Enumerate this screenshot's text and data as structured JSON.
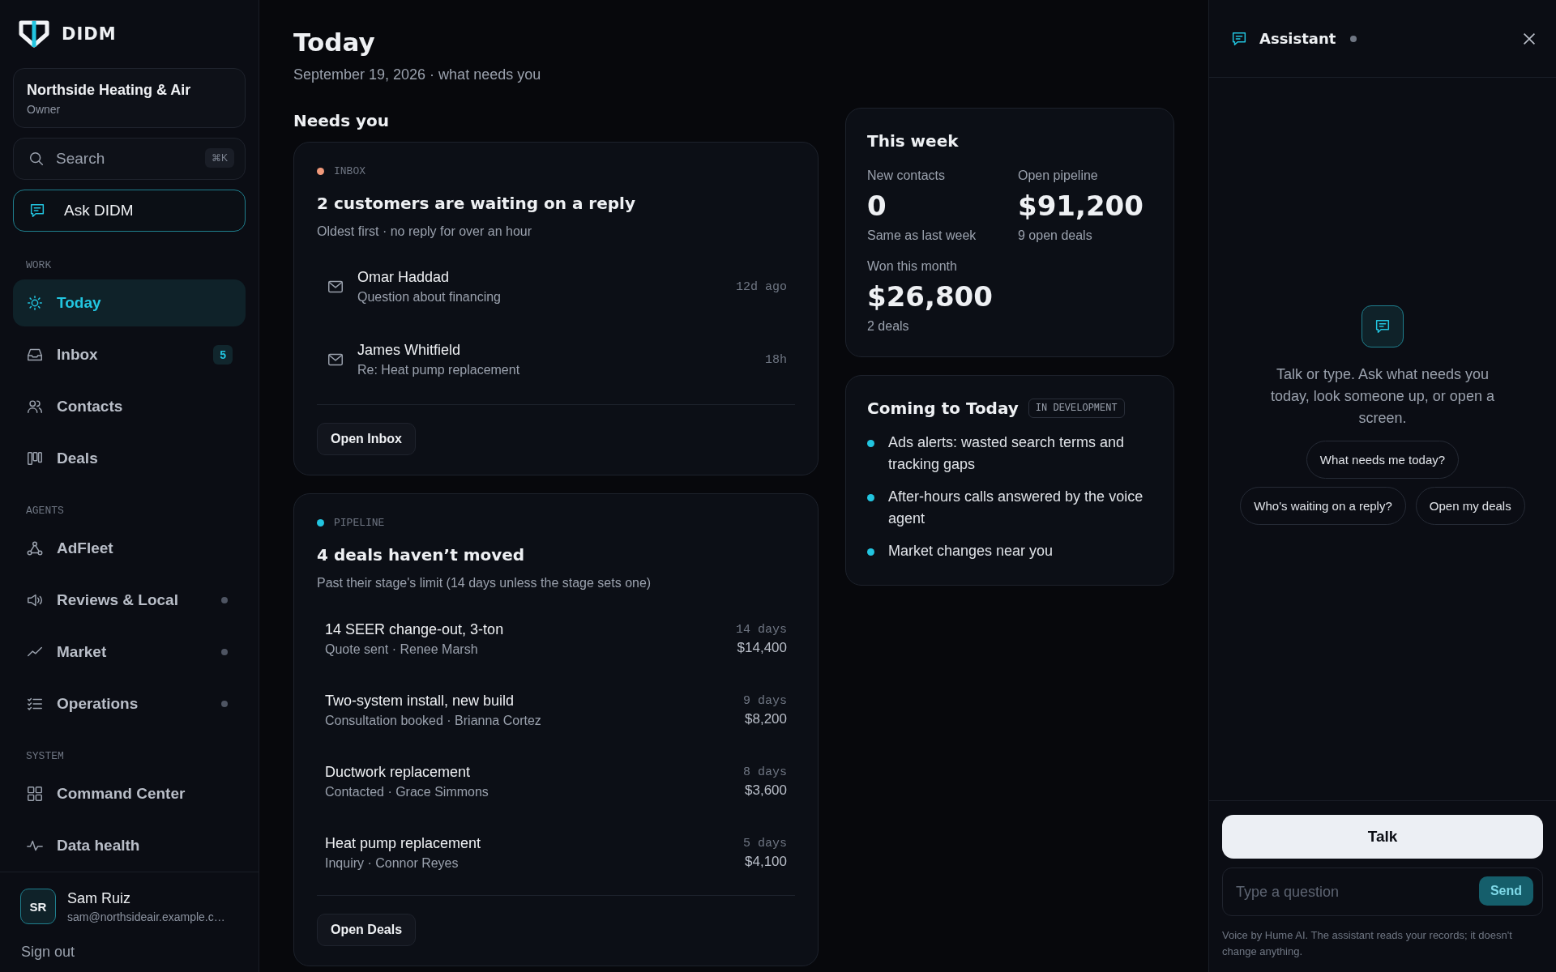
{
  "brand": {
    "name": "DIDM"
  },
  "org": {
    "name": "Northside Heating & Air",
    "role": "Owner"
  },
  "search": {
    "placeholder": "Search",
    "shortcut": "⌘K"
  },
  "ask_button": {
    "label": "Ask DIDM"
  },
  "nav_sections": [
    {
      "heading": "WORK",
      "items": [
        {
          "label": "Today",
          "selected": true,
          "dot": false
        },
        {
          "label": "Inbox",
          "selected": false,
          "dot": false,
          "badge": "5"
        },
        {
          "label": "Contacts",
          "selected": false,
          "dot": false
        },
        {
          "label": "Deals",
          "selected": false,
          "dot": false
        }
      ]
    },
    {
      "heading": "AGENTS",
      "items": [
        {
          "label": "AdFleet",
          "selected": false,
          "dot": false
        },
        {
          "label": "Reviews & Local",
          "selected": false,
          "dot": true
        },
        {
          "label": "Market",
          "selected": false,
          "dot": true
        },
        {
          "label": "Operations",
          "selected": false,
          "dot": true
        }
      ]
    },
    {
      "heading": "SYSTEM",
      "items": [
        {
          "label": "Command Center",
          "selected": false,
          "dot": false
        },
        {
          "label": "Data health",
          "selected": false,
          "dot": false
        }
      ]
    }
  ],
  "user": {
    "initials": "SR",
    "name": "Sam Ruiz",
    "email": "sam@northsideair.example.c…"
  },
  "sign_out": "Sign out",
  "page": {
    "title": "Today",
    "subtitle": "September 19, 2026 · what needs you"
  },
  "needs_you": {
    "heading": "Needs you",
    "cards": [
      {
        "kind": "messages",
        "tag": "INBOX",
        "color": "#f0997a",
        "title": "2 customers are waiting on a reply",
        "subtitle": "Oldest first · no reply for over an hour",
        "button": "Open Inbox",
        "rows": [
          {
            "name": "Omar Haddad",
            "subject": "Question about financing",
            "time": "12d ago"
          },
          {
            "name": "James Whitfield",
            "subject": "Re: Heat pump replacement",
            "time": "18h"
          }
        ]
      },
      {
        "kind": "deals",
        "tag": "PIPELINE",
        "color": "#22c5e0",
        "title": "4 deals haven’t moved",
        "subtitle": "Past their stage's limit (14 days unless the stage sets one)",
        "button": "Open Deals",
        "rows": [
          {
            "title": "14 SEER change-out, 3-ton",
            "meta": "Quote sent · Renee Marsh",
            "age": "14 days",
            "amount": "$14,400"
          },
          {
            "title": "Two-system install, new build",
            "meta": "Consultation booked · Brianna Cortez",
            "age": "9 days",
            "amount": "$8,200"
          },
          {
            "title": "Ductwork replacement",
            "meta": "Contacted · Grace Simmons",
            "age": "8 days",
            "amount": "$3,600"
          },
          {
            "title": "Heat pump replacement",
            "meta": "Inquiry · Connor Reyes",
            "age": "5 days",
            "amount": "$4,100"
          }
        ]
      }
    ]
  },
  "this_week": {
    "title": "This week",
    "stats": [
      {
        "label": "New contacts",
        "value": "0",
        "note": "Same as last week"
      },
      {
        "label": "Open pipeline",
        "value": "$91,200",
        "note": "9 open deals"
      },
      {
        "label": "Won this month",
        "value": "$26,800",
        "note": "2 deals"
      }
    ]
  },
  "coming": {
    "title": "Coming to Today",
    "badge": "IN DEVELOPMENT",
    "items": [
      "Ads alerts: wasted search terms and tracking gaps",
      "After-hours calls answered by the voice agent",
      "Market changes near you"
    ]
  },
  "assistant": {
    "title": "Assistant",
    "prompt": "Talk or type. Ask what needs you today, look someone up, or open a screen.",
    "suggestions": [
      "What needs me today?",
      "Who's waiting on a reply?",
      "Open my deals"
    ],
    "talk_button": "Talk",
    "input": {
      "placeholder": "Type a question"
    },
    "send_button": "Send",
    "footnote": "Voice by Hume AI. The assistant reads your records; it doesn't change anything."
  }
}
